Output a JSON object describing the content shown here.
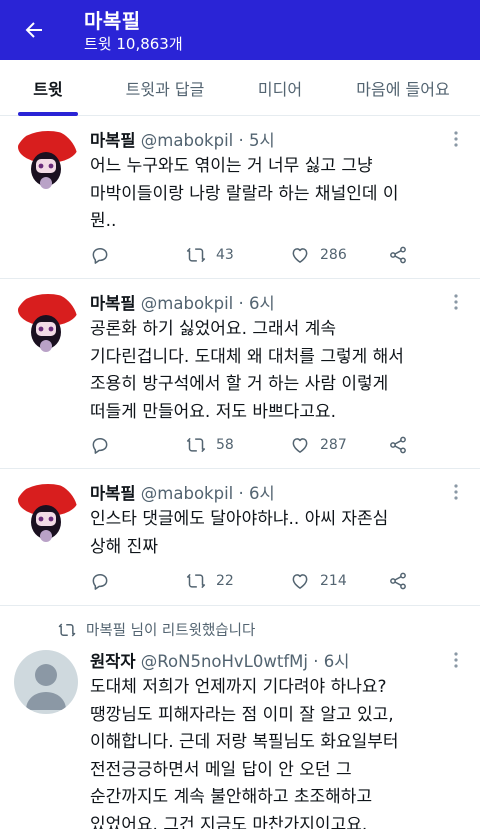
{
  "header": {
    "title": "마복필",
    "subtitle": "트윗 10,863개"
  },
  "tabs": [
    {
      "label": "트윗",
      "active": true
    },
    {
      "label": "트윗과 답글",
      "active": false
    },
    {
      "label": "미디어",
      "active": false
    },
    {
      "label": "마음에 들어요",
      "active": false
    }
  ],
  "tweets": [
    {
      "name": "마복필",
      "handle": "@mabokpil",
      "dot": "·",
      "time": "5시",
      "text": "어느 누구와도 엮이는 거 너무 싫고 그냥\n마박이들이랑 나랑 랄랄라 하는 채널인데 이\n뭔..",
      "retweets": "43",
      "likes": "286"
    },
    {
      "name": "마복필",
      "handle": "@mabokpil",
      "dot": "·",
      "time": "6시",
      "text": "공론화 하기 싫었어요. 그래서 계속\n기다린겁니다. 도대체 왜 대처를 그렇게 해서\n조용히 방구석에서 할 거 하는 사람 이렇게\n떠들게 만들어요. 저도 바쁘다고요.",
      "retweets": "58",
      "likes": "287"
    },
    {
      "name": "마복필",
      "handle": "@mabokpil",
      "dot": "·",
      "time": "6시",
      "text": "인스타 댓글에도 달아야하냐.. 아씨 자존심\n상해 진짜",
      "retweets": "22",
      "likes": "214"
    },
    {
      "retweet_note": "마복필 님이 리트윗했습니다",
      "name": "원작자",
      "handle": "@RoN5noHvL0wtfMj",
      "dot": "·",
      "time": "6시",
      "text": "도대체 저희가 언제까지 기다려야 하나요?\n땡깡님도 피해자라는 점 이미 잘 알고 있고,\n이해합니다. 근데 저랑 복필님도 화요일부터\n전전긍긍하면서 메일 답이 안 오던 그\n순간까지도 계속 불안해하고 초조해하고\n있었어요. 그건 지금도 마찬가지이고요."
    }
  ],
  "colors": {
    "header_bg": "#2a24d6",
    "tab_indicator": "#2a24d6",
    "secondary_text": "#536471"
  },
  "icons": [
    "back-arrow-icon",
    "more-icon",
    "reply-icon",
    "retweet-icon",
    "like-icon",
    "share-icon",
    "default-avatar-icon"
  ]
}
